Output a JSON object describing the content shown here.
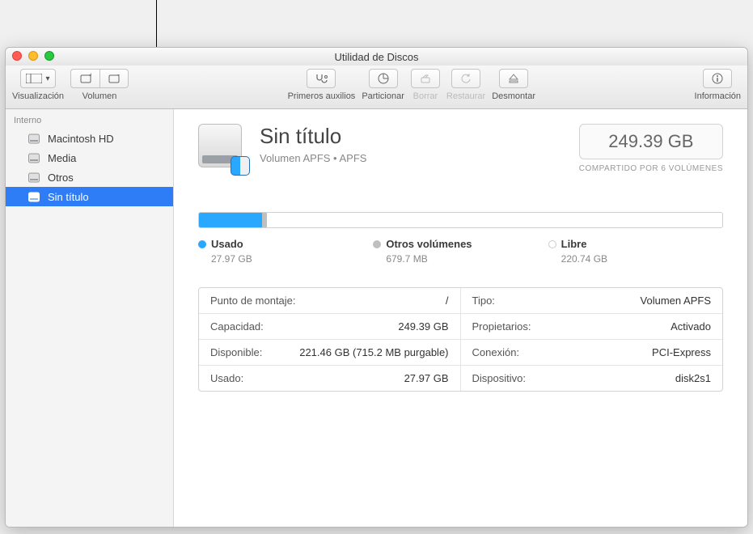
{
  "window": {
    "title": "Utilidad de Discos"
  },
  "toolbar": {
    "view_label": "Visualización",
    "volume_label": "Volumen",
    "firstaid_label": "Primeros auxilios",
    "partition_label": "Particionar",
    "erase_label": "Borrar",
    "restore_label": "Restaurar",
    "unmount_label": "Desmontar",
    "info_label": "Información"
  },
  "sidebar": {
    "header": "Interno",
    "items": [
      {
        "label": "Macintosh HD"
      },
      {
        "label": "Media"
      },
      {
        "label": "Otros"
      },
      {
        "label": "Sin título"
      }
    ],
    "selected_index": 3
  },
  "volume": {
    "name": "Sin título",
    "subtitle": "Volumen APFS • APFS",
    "size": "249.39 GB",
    "shared_note": "COMPARTIDO POR 6 VOLÚMENES"
  },
  "usage": {
    "used_pct": 12,
    "other_pct": 1,
    "legend": {
      "used": {
        "label": "Usado",
        "value": "27.97 GB",
        "color": "#2aa8ff"
      },
      "other": {
        "label": "Otros volúmenes",
        "value": "679.7 MB",
        "color": "#bfbfbf"
      },
      "free": {
        "label": "Libre",
        "value": "220.74 GB",
        "color": "#ffffff"
      }
    }
  },
  "info": {
    "left": [
      {
        "k": "Punto de montaje:",
        "v": "/"
      },
      {
        "k": "Capacidad:",
        "v": "249.39 GB"
      },
      {
        "k": "Disponible:",
        "v": "221.46 GB (715.2 MB purgable)"
      },
      {
        "k": "Usado:",
        "v": "27.97 GB"
      }
    ],
    "right": [
      {
        "k": "Tipo:",
        "v": "Volumen APFS"
      },
      {
        "k": "Propietarios:",
        "v": "Activado"
      },
      {
        "k": "Conexión:",
        "v": "PCI-Express"
      },
      {
        "k": "Dispositivo:",
        "v": "disk2s1"
      }
    ]
  }
}
